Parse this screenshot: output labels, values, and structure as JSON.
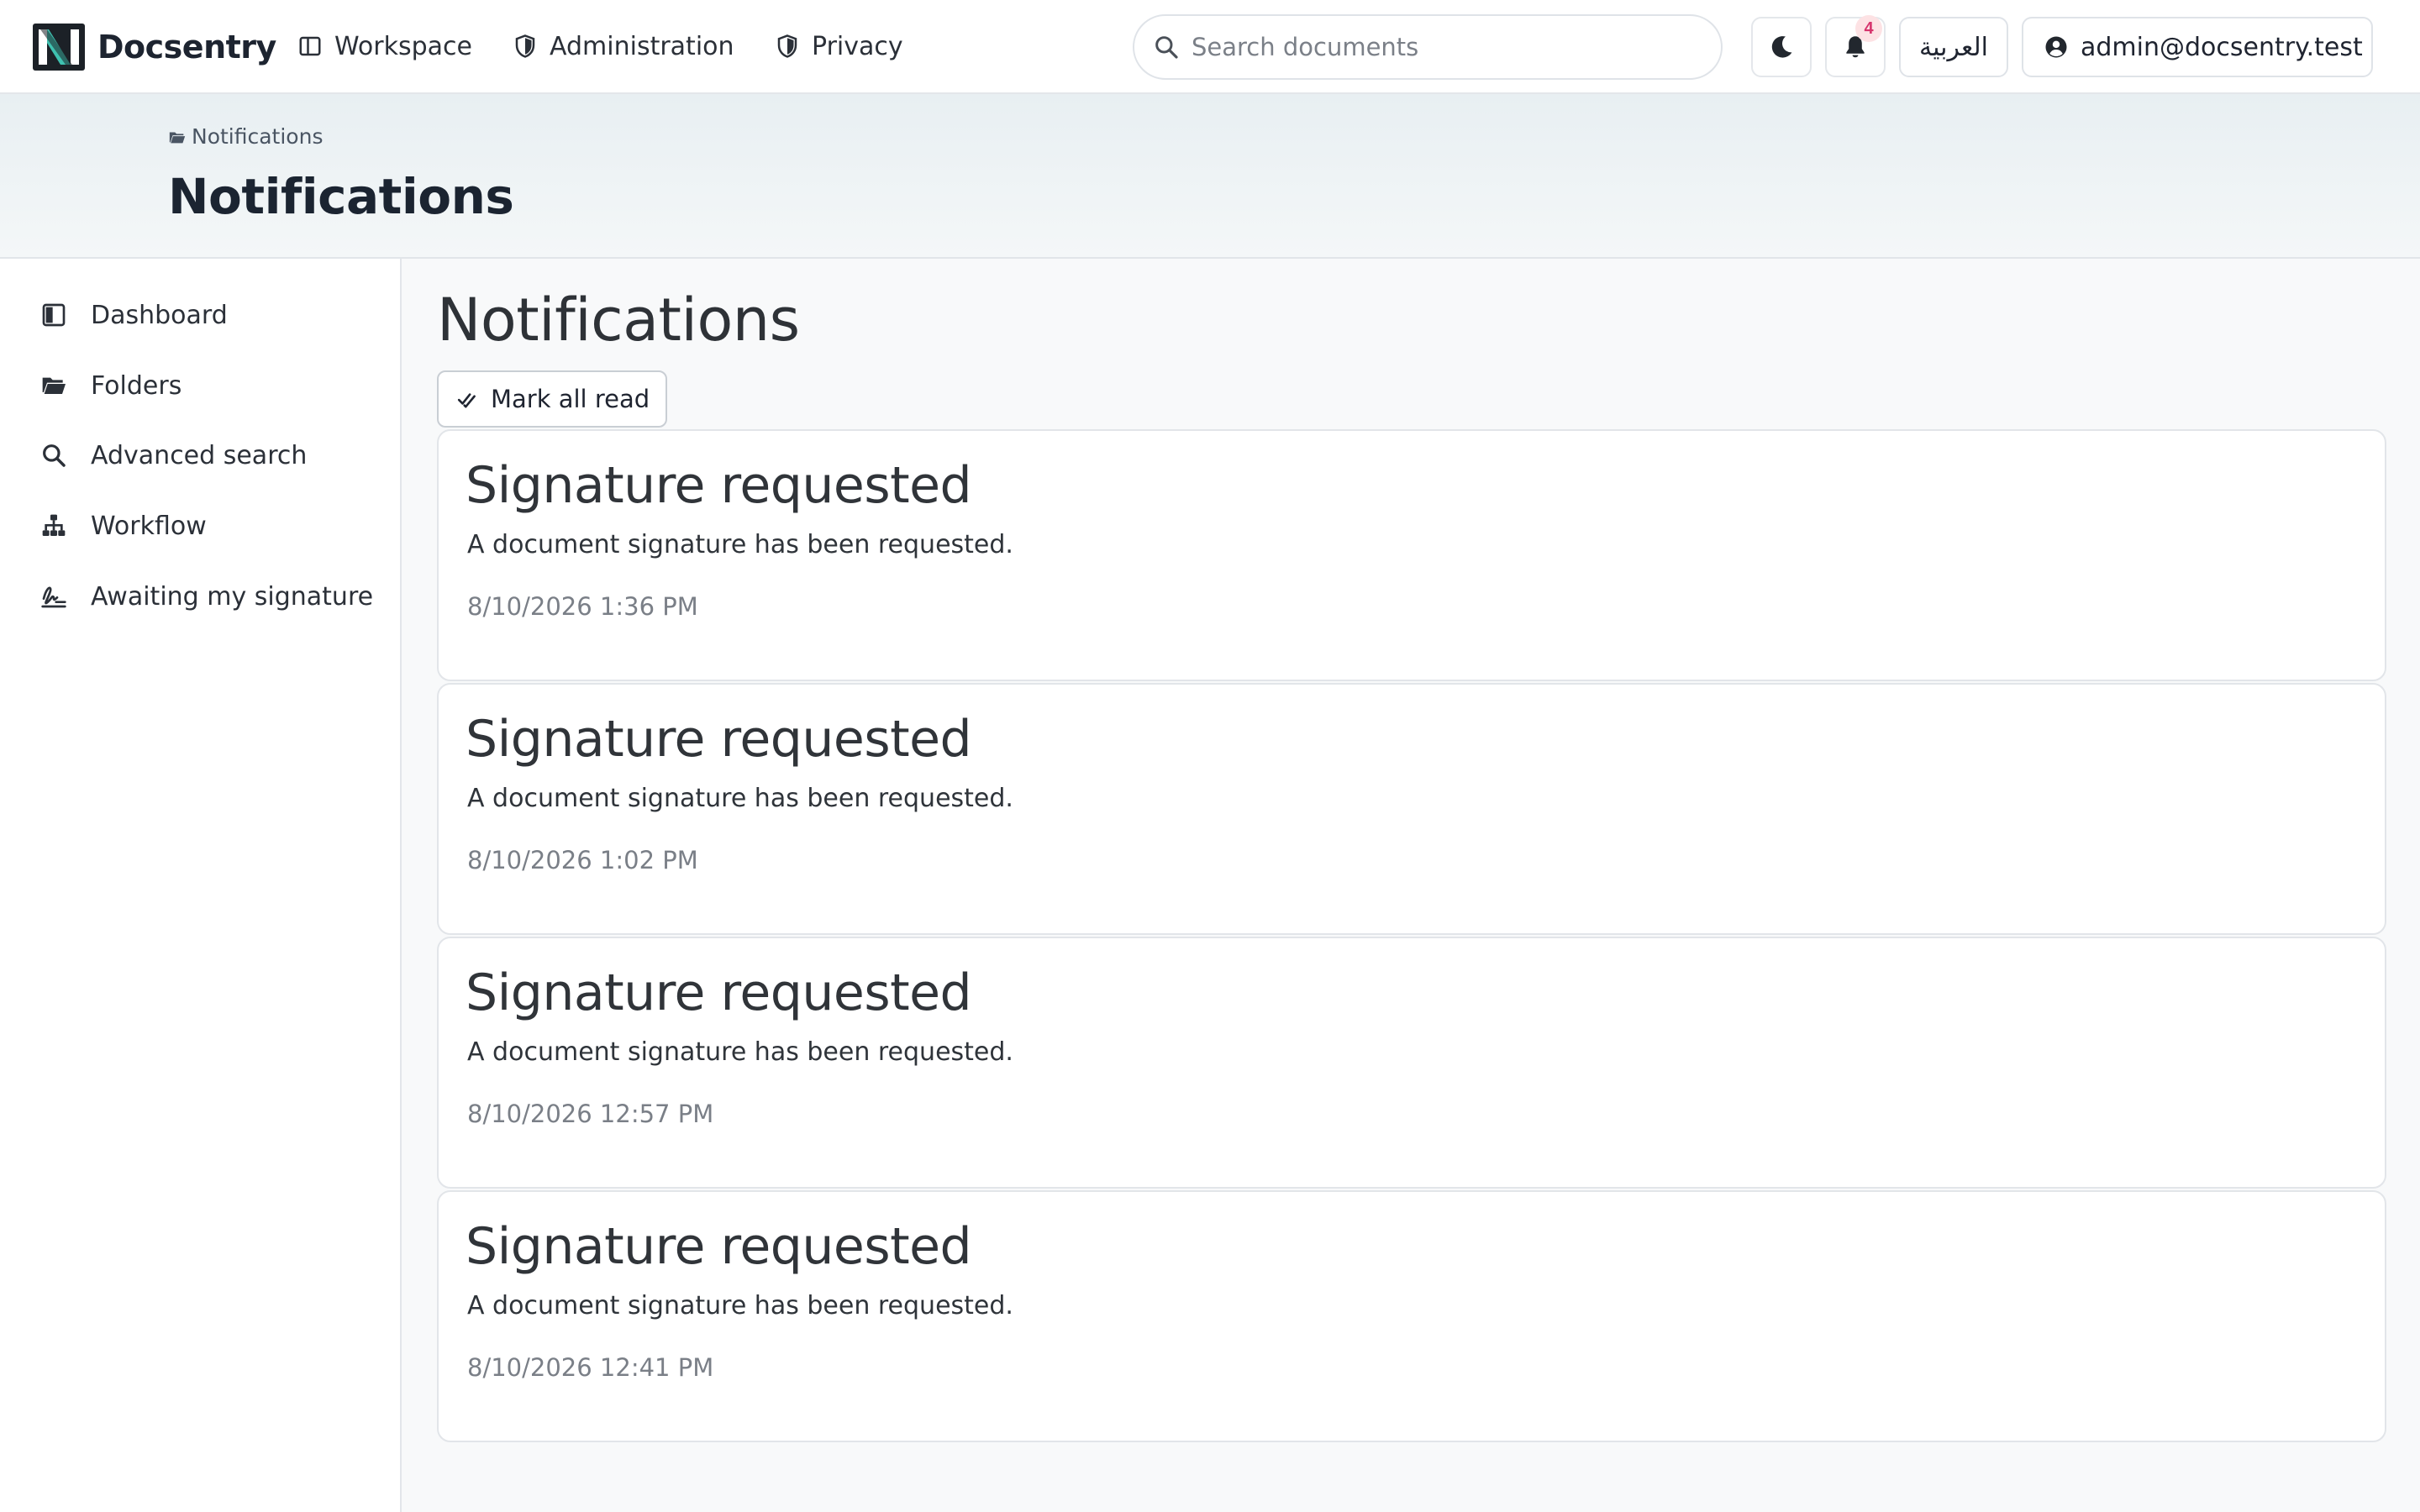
{
  "brand": {
    "name": "Docsentry"
  },
  "nav": {
    "items": [
      {
        "label": "Workspace",
        "icon": "layout-icon"
      },
      {
        "label": "Administration",
        "icon": "shield-icon"
      },
      {
        "label": "Privacy",
        "icon": "shield-icon"
      }
    ]
  },
  "search": {
    "placeholder": "Search documents",
    "value": ""
  },
  "header_actions": {
    "theme_icon": "moon-icon",
    "notification_count": "4",
    "language_label": "العربية",
    "user_email": "admin@docsentry.test"
  },
  "page_header": {
    "breadcrumb": "Notifications",
    "title": "Notifications"
  },
  "sidebar": {
    "items": [
      {
        "label": "Dashboard",
        "icon": "dashboard-icon"
      },
      {
        "label": "Folders",
        "icon": "folder-open-icon"
      },
      {
        "label": "Advanced search",
        "icon": "search-icon"
      },
      {
        "label": "Workflow",
        "icon": "sitemap-icon"
      },
      {
        "label": "Awaiting my signature",
        "icon": "signature-icon"
      }
    ]
  },
  "main": {
    "title": "Notifications",
    "mark_all_read_label": "Mark all read",
    "notifications": [
      {
        "title": "Signature requested",
        "message": "A document signature has been requested.",
        "time": "8/10/2026 1:36 PM"
      },
      {
        "title": "Signature requested",
        "message": "A document signature has been requested.",
        "time": "8/10/2026 1:02 PM"
      },
      {
        "title": "Signature requested",
        "message": "A document signature has been requested.",
        "time": "8/10/2026 12:57 PM"
      },
      {
        "title": "Signature requested",
        "message": "A document signature has been requested.",
        "time": "8/10/2026 12:41 PM"
      }
    ]
  },
  "colors": {
    "brand_teal": "#3fc1b0",
    "badge_text": "#d6336c",
    "badge_bg": "#fde2e4",
    "header_band": "#e8eff2"
  }
}
